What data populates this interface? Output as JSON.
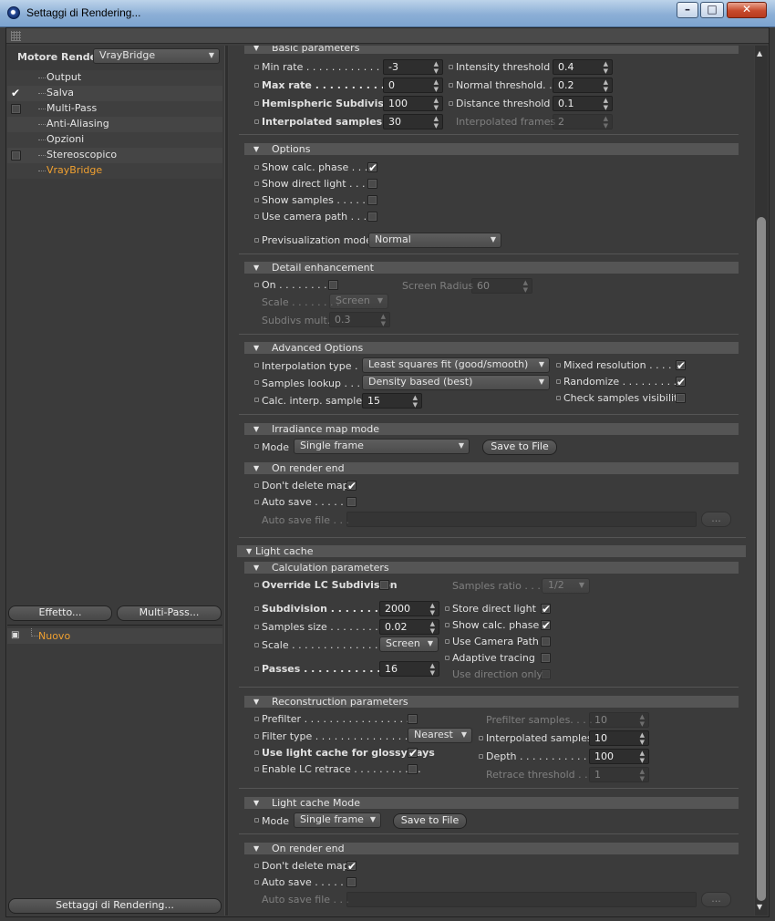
{
  "window": {
    "title": "Settaggi di Rendering..."
  },
  "left": {
    "renderer_label": "Motore Render",
    "renderer_value": "VrayBridge",
    "items": [
      {
        "label": "Output"
      },
      {
        "label": "Salva"
      },
      {
        "label": "Multi-Pass"
      },
      {
        "label": "Anti-Aliasing"
      },
      {
        "label": "Opzioni"
      },
      {
        "label": "Stereoscopico"
      },
      {
        "label": "VrayBridge"
      }
    ],
    "effect_btn": "Effetto...",
    "multipass_btn": "Multi-Pass...",
    "preset_label": "Nuovo",
    "bottom_btn": "Settaggi di Rendering..."
  },
  "basic": {
    "title": "Basic parameters",
    "min_rate_l": "Min rate . . . . . . . . . . . . . . .",
    "min_rate_v": "-3",
    "max_rate_l": "Max rate . . . . . . . . . . . . . . .",
    "max_rate_v": "0",
    "hemi_l": "Hemispheric Subdivision",
    "hemi_v": "100",
    "interp_l": "Interpolated samples . . .",
    "interp_v": "30",
    "int_thr_l": "Intensity threshold",
    "int_thr_v": "0.4",
    "norm_thr_l": "Normal threshold. .",
    "norm_thr_v": "0.2",
    "dist_thr_l": "Distance threshold",
    "dist_thr_v": "0.1",
    "interp_frames_l": "Interpolated frames",
    "interp_frames_v": "2"
  },
  "options": {
    "title": "Options",
    "show_calc": "Show calc. phase . . . .",
    "show_direct": "Show direct light . . . .",
    "show_samples": "Show samples . . . . . .",
    "use_cam": "Use camera path . . . .",
    "previs_l": "Previsualization mode",
    "previs_v": "Normal"
  },
  "detail": {
    "title": "Detail enhancement",
    "on": "On . . . . . . . . .",
    "screen_radius_l": "Screen Radius",
    "screen_radius_v": "60",
    "scale_l": "Scale . . . . . . . .",
    "scale_v": "Screen",
    "subdivs_l": "Subdivs mult.",
    "subdivs_v": "0.3"
  },
  "advanced": {
    "title": "Advanced Options",
    "interp_type_l": "Interpolation type . . .",
    "interp_type_v": "Least squares fit (good/smooth)",
    "samples_lookup_l": "Samples lookup . . . .",
    "samples_lookup_v": "Density based (best)",
    "calc_interp_l": "Calc. interp. samples",
    "calc_interp_v": "15",
    "mixed": "Mixed resolution . . . . .",
    "randomize": "Randomize . . . . . . . . . .",
    "check_vis": "Check samples visibility"
  },
  "irr_mode": {
    "title": "Irradiance map mode",
    "mode_l": "Mode",
    "mode_v": "Single frame",
    "save_btn": "Save to File"
  },
  "irr_end": {
    "title": "On render end",
    "dont_delete": "Don't delete map",
    "auto_save": "Auto save . . . . . .",
    "auto_file": "Auto save file . . .",
    "browse": "..."
  },
  "lc": {
    "title": "Light cache"
  },
  "calc": {
    "title": "Calculation parameters",
    "override": "Override LC Subdivision",
    "ratio_l": "Samples ratio . . .",
    "ratio_v": "1/2",
    "subdiv_l": "Subdivision . . . . . . . . . .",
    "subdiv_v": "2000",
    "ssize_l": "Samples size . . . . . . . . .",
    "ssize_v": "0.02",
    "scale_l": "Scale . . . . . . . . . . . . . . .",
    "scale_v": "Screen",
    "passes_l": "Passes . . . . . . . . . . . . . .",
    "passes_v": "16",
    "store_direct": "Store direct light",
    "show_calc": "Show calc. phase",
    "use_cam": "Use Camera Path",
    "adaptive": "Adaptive tracing",
    "use_dir": "Use direction only"
  },
  "recon": {
    "title": "Reconstruction parameters",
    "prefilter": "Prefilter . . . . . . . . . . . . . . . . . .",
    "filter_l": "Filter type . . . . . . . . . . . . . . . .",
    "filter_v": "Nearest",
    "glossy": "Use light cache for glossy rays",
    "retrace": "Enable LC retrace . . . . . . . . . . .",
    "pre_samples_l": "Prefilter samples. . . .",
    "pre_samples_v": "10",
    "interp_l": "Interpolated samples",
    "interp_v": "10",
    "depth_l": "Depth . . . . . . . . . . . . .",
    "depth_v": "100",
    "retrace_thr_l": "Retrace threshold . .",
    "retrace_thr_v": "1"
  },
  "lc_mode": {
    "title": "Light cache Mode",
    "mode_l": "Mode",
    "mode_v": "Single frame",
    "save_btn": "Save to File"
  },
  "lc_end": {
    "title": "On render end",
    "dont_delete": "Don't delete map",
    "auto_save": "Auto save . . . . . .",
    "auto_file": "Auto save file . . .",
    "browse": "..."
  }
}
